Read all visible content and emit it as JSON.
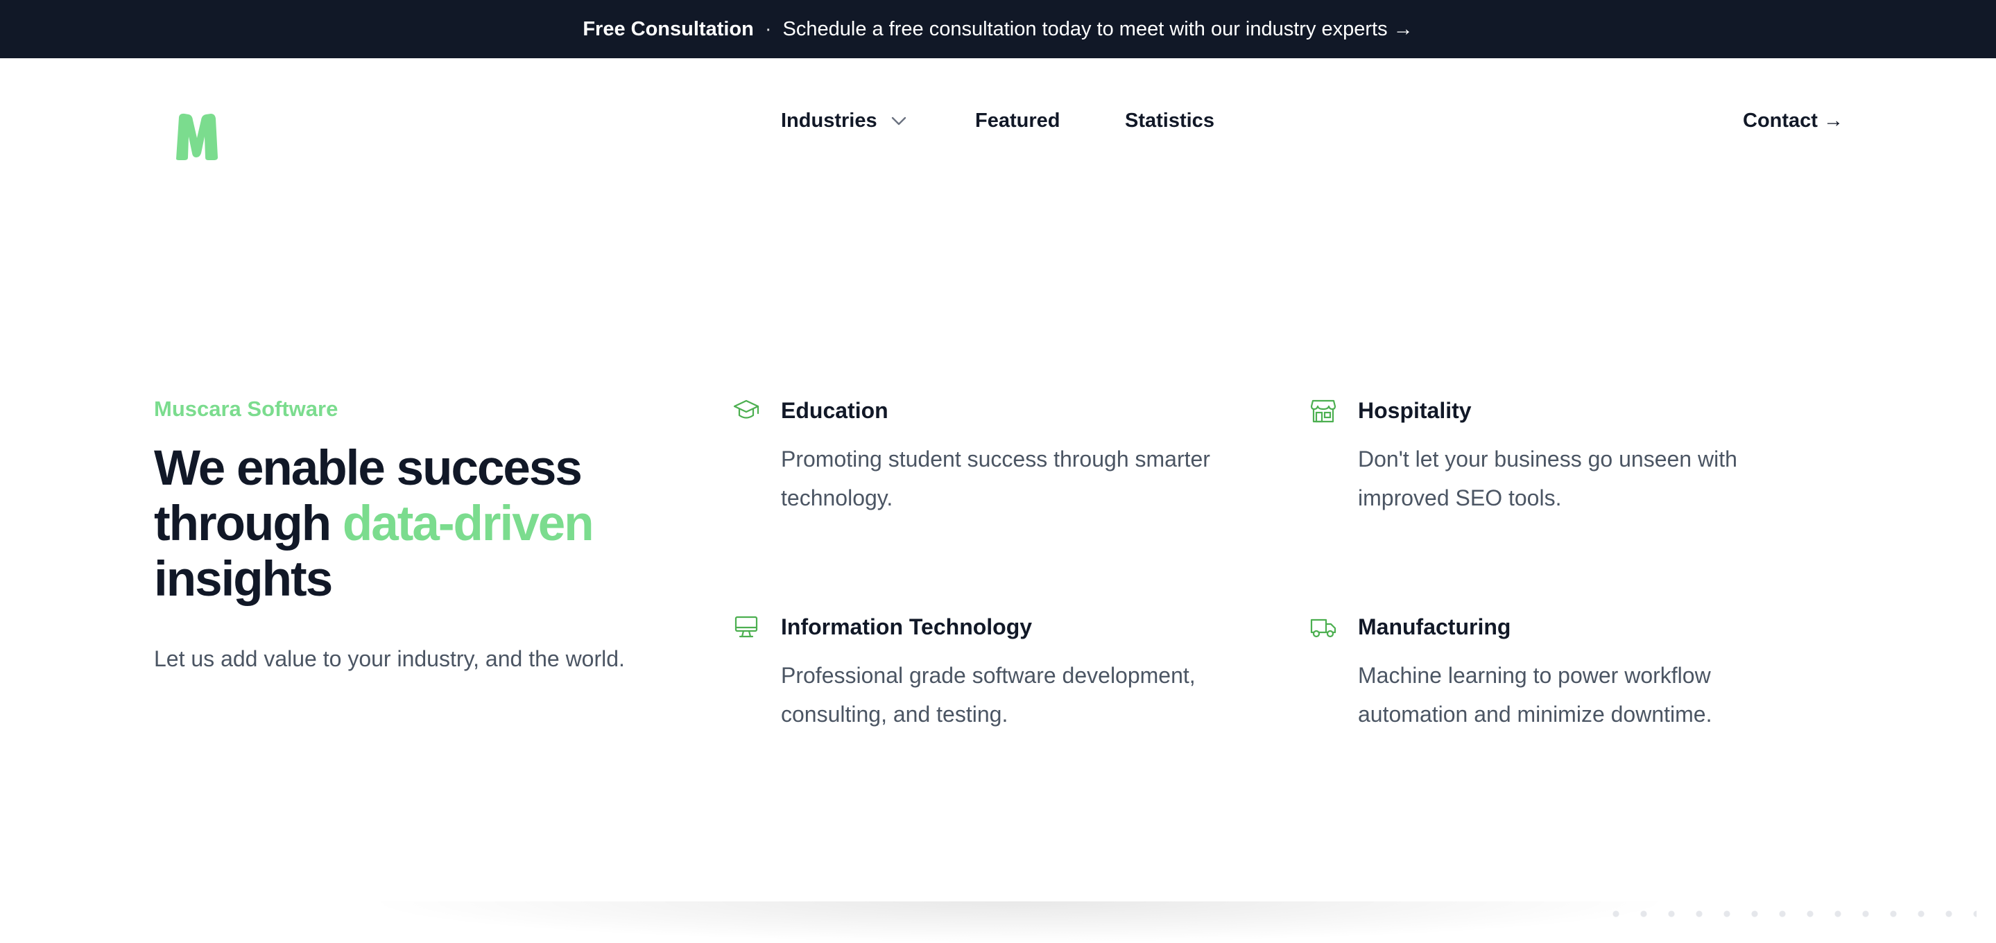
{
  "banner": {
    "strong": "Free Consultation",
    "separator": "·",
    "text": "Schedule a free consultation today to meet with our industry experts →"
  },
  "logo": {
    "letter": "M",
    "color": "#7bdc8e"
  },
  "nav": {
    "industries": "Industries",
    "featured": "Featured",
    "statistics": "Statistics",
    "contact": "Contact →"
  },
  "hero": {
    "eyebrow": "Muscara Software",
    "headline_part1": "We enable success through ",
    "headline_accent": "data-driven",
    "headline_part2": " insights",
    "subtext": "Let us add value to your industry, and the world."
  },
  "features": [
    {
      "icon": "graduation-cap-icon",
      "title": "Education",
      "description": "Promoting student success through smarter technology."
    },
    {
      "icon": "storefront-icon",
      "title": "Hospitality",
      "description": "Don't let your business go unseen with improved SEO tools."
    },
    {
      "icon": "computer-monitor-icon",
      "title": "Information Technology",
      "description": "Professional grade software development, consulting, and testing."
    },
    {
      "icon": "delivery-truck-icon",
      "title": "Manufacturing",
      "description": "Machine learning to power workflow automation and minimize downtime."
    }
  ],
  "colors": {
    "accent": "#7bdc8e",
    "icon": "#4caf50",
    "dark": "#111827",
    "muted": "#4b5563"
  }
}
